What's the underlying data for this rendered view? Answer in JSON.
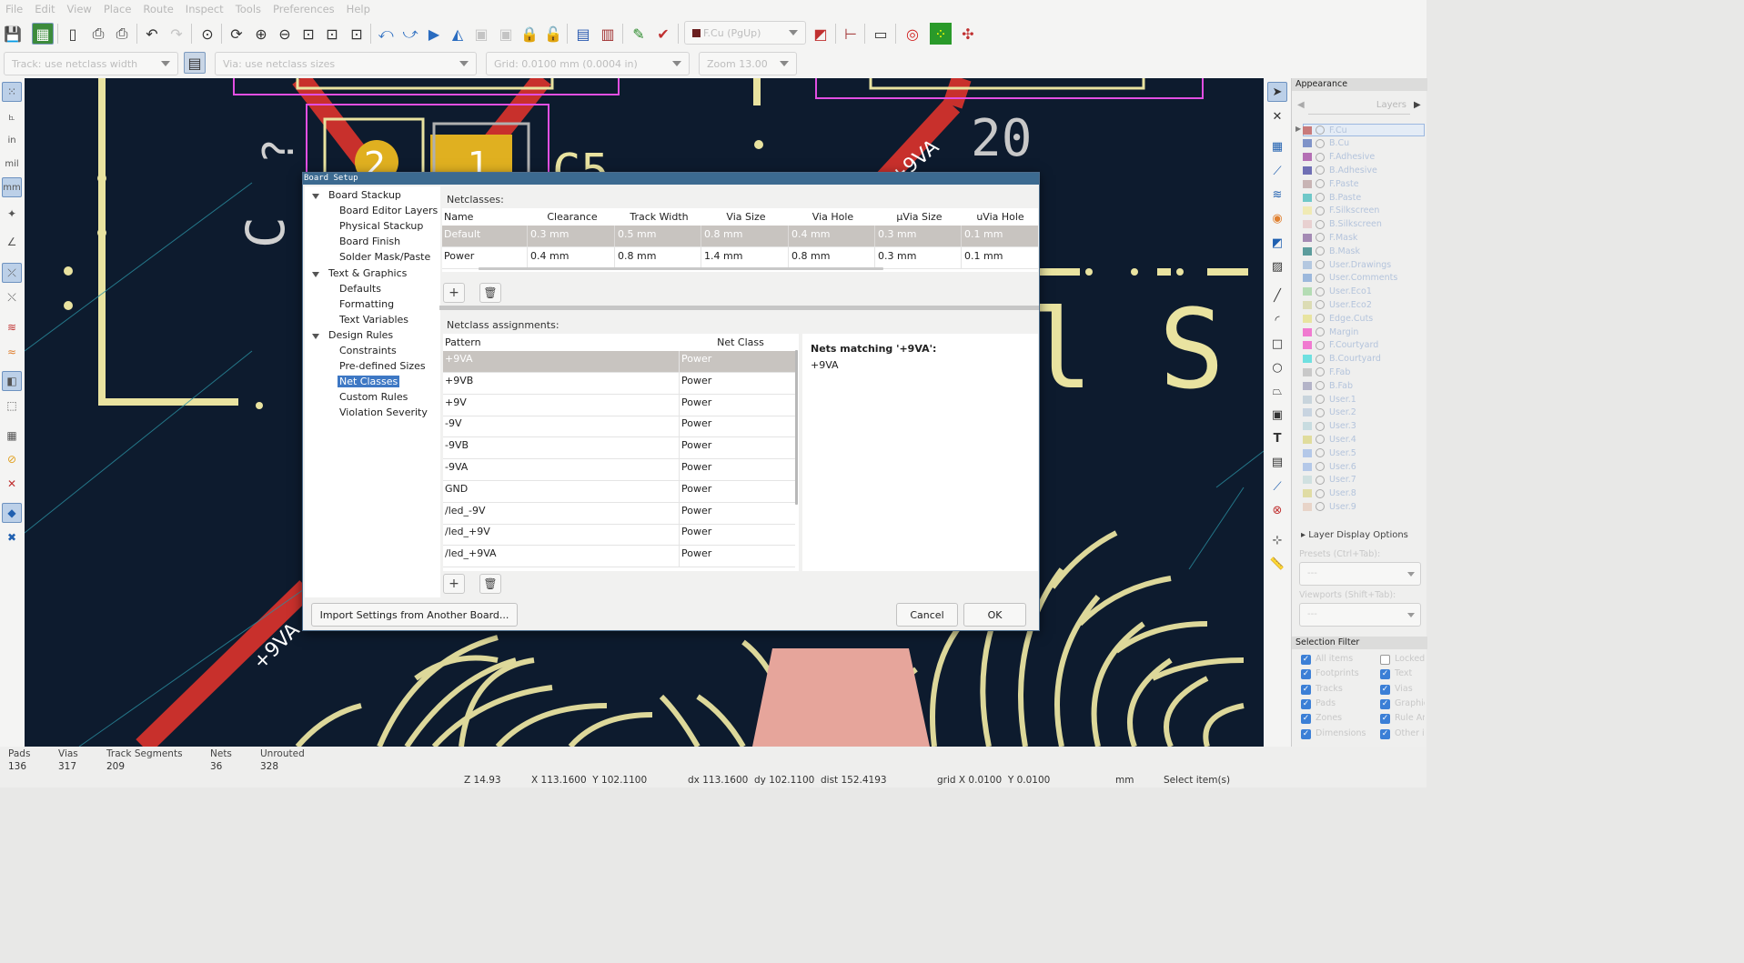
{
  "menu": [
    "File",
    "Edit",
    "View",
    "Place",
    "Route",
    "Inspect",
    "Tools",
    "Preferences",
    "Help"
  ],
  "toolbar": {
    "layer_select": "F.Cu (PgUp)",
    "icons": [
      "save-icon",
      "board-setup-icon",
      "page-settings-icon",
      "print-icon",
      "plot-icon",
      "undo-icon",
      "redo-icon",
      "find-icon",
      "refresh-icon",
      "zoom-in-icon",
      "zoom-out-icon",
      "zoom-fit-icon",
      "zoom-objects-icon",
      "zoom-selection-icon",
      "rotate-ccw-icon",
      "rotate-cw-icon",
      "flip-icon",
      "mirror-icon",
      "group-icon",
      "ungroup-icon",
      "lock-icon",
      "unlock-icon",
      "netlist-icon",
      "footprint-library-icon",
      "footprint-editor-icon",
      "drc-icon",
      "layer-pair-icon",
      "scripting-icon",
      "console-icon",
      "fill-zones-icon",
      "zones-icon",
      "design-blocks-icon"
    ]
  },
  "toolbar2": {
    "track": "Track: use netclass width",
    "via": "Via: use netclass sizes",
    "grid": "Grid: 0.0100 mm (0.0004 in)",
    "zoom": "Zoom 13.00"
  },
  "left_toolbar": {
    "units_in": "in",
    "units_mil": "mil",
    "units_mm": "mm"
  },
  "canvas_text": {
    "silk_c": "C",
    "silk_q": "?",
    "pad_two": "2",
    "pad_one": "1",
    "ref_c5": "C5",
    "ref_20": "20",
    "net_9va_top": "+9VA",
    "net_9va_bottom": "+9VA",
    "silk_al": "al S",
    "silk_l": "L"
  },
  "dialog": {
    "title": "Board Setup",
    "tree": [
      {
        "label": "Board Stackup",
        "level": 0,
        "expanded": true
      },
      {
        "label": "Board Editor Layers",
        "level": 1
      },
      {
        "label": "Physical Stackup",
        "level": 1
      },
      {
        "label": "Board Finish",
        "level": 1
      },
      {
        "label": "Solder Mask/Paste",
        "level": 1
      },
      {
        "label": "Text & Graphics",
        "level": 0,
        "expanded": true
      },
      {
        "label": "Defaults",
        "level": 1
      },
      {
        "label": "Formatting",
        "level": 1
      },
      {
        "label": "Text Variables",
        "level": 1
      },
      {
        "label": "Design Rules",
        "level": 0,
        "expanded": true
      },
      {
        "label": "Constraints",
        "level": 1
      },
      {
        "label": "Pre-defined Sizes",
        "level": 1
      },
      {
        "label": "Net Classes",
        "level": 1,
        "selected": true
      },
      {
        "label": "Custom Rules",
        "level": 1
      },
      {
        "label": "Violation Severity",
        "level": 1
      }
    ],
    "netclasses_label": "Netclasses:",
    "netclass_columns": [
      "Name",
      "Clearance",
      "Track Width",
      "Via Size",
      "Via Hole",
      "µVia Size",
      "uVia Hole"
    ],
    "netclass_rows": [
      [
        "Default",
        "0.3 mm",
        "0.5 mm",
        "0.8 mm",
        "0.4 mm",
        "0.3 mm",
        "0.1 mm"
      ],
      [
        "Power",
        "0.4 mm",
        "0.8 mm",
        "1.4 mm",
        "0.8 mm",
        "0.3 mm",
        "0.1 mm"
      ]
    ],
    "assignments_label": "Netclass assignments:",
    "assignment_columns": [
      "Pattern",
      "Net Class"
    ],
    "assignment_rows": [
      [
        "+9VA",
        "Power"
      ],
      [
        "+9VB",
        "Power"
      ],
      [
        "+9V",
        "Power"
      ],
      [
        "-9V",
        "Power"
      ],
      [
        "-9VB",
        "Power"
      ],
      [
        "-9VA",
        "Power"
      ],
      [
        "GND",
        "Power"
      ],
      [
        "/led_-9V",
        "Power"
      ],
      [
        "/led_+9V",
        "Power"
      ],
      [
        "/led_+9VA",
        "Power"
      ]
    ],
    "matching_title": "Nets matching '+9VA':",
    "matching_nets": [
      "+9VA"
    ],
    "add_symbol": "+",
    "delete_symbol": "🗑",
    "import_button": "Import Settings from Another Board...",
    "cancel_button": "Cancel",
    "ok_button": "OK"
  },
  "appearance": {
    "title": "Appearance",
    "tab_layers": "Layers",
    "layers": [
      {
        "name": "F.Cu",
        "color": "#c87a7a"
      },
      {
        "name": "B.Cu",
        "color": "#7f93c8"
      },
      {
        "name": "F.Adhesive",
        "color": "#b46fb4"
      },
      {
        "name": "B.Adhesive",
        "color": "#6f6fb4"
      },
      {
        "name": "F.Paste",
        "color": "#c8b4b4"
      },
      {
        "name": "B.Paste",
        "color": "#6fc8c8"
      },
      {
        "name": "F.Silkscreen",
        "color": "#f0eab4"
      },
      {
        "name": "B.Silkscreen",
        "color": "#e8d0d0"
      },
      {
        "name": "F.Mask",
        "color": "#a48ab4"
      },
      {
        "name": "B.Mask",
        "color": "#5c9c9c"
      },
      {
        "name": "User.Drawings",
        "color": "#b4c8e0"
      },
      {
        "name": "User.Comments",
        "color": "#9cb8dc"
      },
      {
        "name": "User.Eco1",
        "color": "#b4dcb4"
      },
      {
        "name": "User.Eco2",
        "color": "#dcdcb4"
      },
      {
        "name": "Edge.Cuts",
        "color": "#e8e4a0"
      },
      {
        "name": "Margin",
        "color": "#f07ad0"
      },
      {
        "name": "F.Courtyard",
        "color": "#f07ad0"
      },
      {
        "name": "B.Courtyard",
        "color": "#6fe0e0"
      },
      {
        "name": "F.Fab",
        "color": "#c8c8c8"
      },
      {
        "name": "B.Fab",
        "color": "#b4b4c8"
      },
      {
        "name": "User.1",
        "color": "#c8d4dc"
      },
      {
        "name": "User.2",
        "color": "#c8d4e0"
      },
      {
        "name": "User.3",
        "color": "#c8dce0"
      },
      {
        "name": "User.4",
        "color": "#e0dc9c"
      },
      {
        "name": "User.5",
        "color": "#b4c8e8"
      },
      {
        "name": "User.6",
        "color": "#b4c8e8"
      },
      {
        "name": "User.7",
        "color": "#d0e0e0"
      },
      {
        "name": "User.8",
        "color": "#e0dca4"
      },
      {
        "name": "User.9",
        "color": "#e8d4c8"
      }
    ],
    "layer_display_options": "Layer Display Options",
    "presets_label": "Presets (Ctrl+Tab):",
    "presets_value": "---",
    "viewports_label": "Viewports (Shift+Tab):",
    "viewports_value": "---",
    "selection_filter": "Selection Filter",
    "filter_items": [
      {
        "label": "All items",
        "checked": true
      },
      {
        "label": "Locked",
        "checked": false
      },
      {
        "label": "Footprints",
        "checked": true
      },
      {
        "label": "Text",
        "checked": true
      },
      {
        "label": "Tracks",
        "checked": true
      },
      {
        "label": "Vias",
        "checked": true
      },
      {
        "label": "Pads",
        "checked": true
      },
      {
        "label": "Graphics",
        "checked": true
      },
      {
        "label": "Zones",
        "checked": true
      },
      {
        "label": "Rule Areas",
        "checked": true
      },
      {
        "label": "Dimensions",
        "checked": true
      },
      {
        "label": "Other items",
        "checked": true
      }
    ]
  },
  "status": {
    "pads_label": "Pads",
    "pads": "136",
    "vias_label": "Vias",
    "vias": "317",
    "tracks_label": "Track Segments",
    "tracks": "209",
    "nets_label": "Nets",
    "nets": "36",
    "unrouted_label": "Unrouted",
    "unrouted": "328",
    "zoom": "Z 14.93",
    "xy": "X 113.1600  Y 102.1100",
    "dxy": "dx 113.1600  dy 102.1100  dist 152.4193",
    "grid": "grid X 0.0100  Y 0.0100",
    "units": "mm",
    "mode": "Select item(s)"
  }
}
